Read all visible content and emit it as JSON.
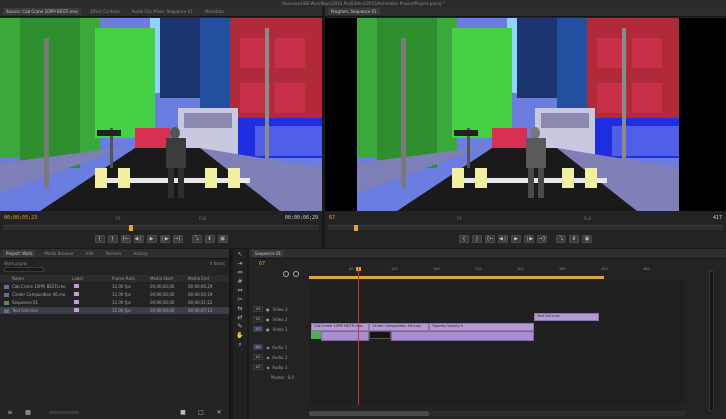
{
  "window": {
    "title": "/Volumes/USB Workflows/2015 Pro/Edition/2015/Animation Project/Project.prproj *"
  },
  "source_monitor": {
    "tabs": [
      "Source: Cab Crane 10PPI BESTI.mov",
      "Effect Controls",
      "Audio Clip Mixer: Sequence 01",
      "Metadata"
    ],
    "timecode_in": "00;00;05;23",
    "timecode_out": "00;00;06;29",
    "zoom": "Fit",
    "resolution": "Full"
  },
  "program_monitor": {
    "tabs": [
      "Program: Sequence 01"
    ],
    "timecode_in": "67",
    "timecode_out": "417",
    "zoom": "Fit",
    "resolution": "Full"
  },
  "project_panel": {
    "tabs": [
      "Project: Work",
      "Media Browser",
      "Info",
      "Markers",
      "History"
    ],
    "project_name": "Work.prproj",
    "items_count": "4 Items",
    "columns": [
      "Name",
      "Label",
      "Frame Rate",
      "Media Start",
      "Media End"
    ],
    "rows": [
      {
        "name": "Cab Crane 10PPI BESTI.mo",
        "frame_rate": "12.00 fps",
        "media_start": "00;00;00;00",
        "media_end": "00;00;06;29"
      },
      {
        "name": "Cinder Composition 46.mo",
        "frame_rate": "12.00 fps",
        "media_start": "00;00;00;00",
        "media_end": "00;00;04;19"
      },
      {
        "name": "Sequence 01",
        "frame_rate": "12.00 fps",
        "media_start": "00;00;00;00",
        "media_end": "00;00;31;22"
      },
      {
        "name": "Text Fall.mov",
        "frame_rate": "12.00 fps",
        "media_start": "00;00;00;00",
        "media_end": "00;00;07;13"
      }
    ]
  },
  "timeline": {
    "tabs": [
      "Sequence 01"
    ],
    "timecode": "67",
    "ruler_ticks": [
      "60",
      "120",
      "180",
      "240",
      "300",
      "360",
      "420",
      "480"
    ],
    "tracks": {
      "v3": "Video 3",
      "v2": "Video 2",
      "v1": "Video 1",
      "a1": "Audio 1",
      "a2": "Audio 2",
      "a3": "Audio 3",
      "master": "Master"
    },
    "track_ids": {
      "v3": "V3",
      "v2": "V2",
      "v1": "V1",
      "a1": "A1",
      "a2": "A2",
      "a3": "A3"
    },
    "master_value": "0.0",
    "clips": {
      "text_fall": "Text Fall.mov",
      "cab_crane": "Cab Crane 10PPI BESTI.mov",
      "cinder": "Cinder Composition 46.mov",
      "opacity": "Opacity:Opacity ▾"
    }
  },
  "icons": {
    "play": "▶",
    "step_back": "◀❘",
    "step_fwd": "❘▶",
    "mark_in": "{",
    "mark_out": "}",
    "goto_in": "{←",
    "goto_out": "→}",
    "insert": "⤵",
    "overwrite": "⬇",
    "export": "▣",
    "settings": "⚙",
    "selection": "↖",
    "track_select": "⇥",
    "ripple": "⇔",
    "rolling": "#",
    "rate": "↭",
    "razor": "✂",
    "slip": "⇆",
    "slide": "⇄",
    "pen": "✎",
    "hand": "✋",
    "zoom": "⌕",
    "list_view": "≡",
    "icon_view": "▦",
    "new_bin": "■",
    "new_item": "□",
    "clear": "✕"
  },
  "colors": {
    "accent": "#e8a03a",
    "clip_violet": "#b49bd4",
    "playhead_red": "#d03030"
  }
}
